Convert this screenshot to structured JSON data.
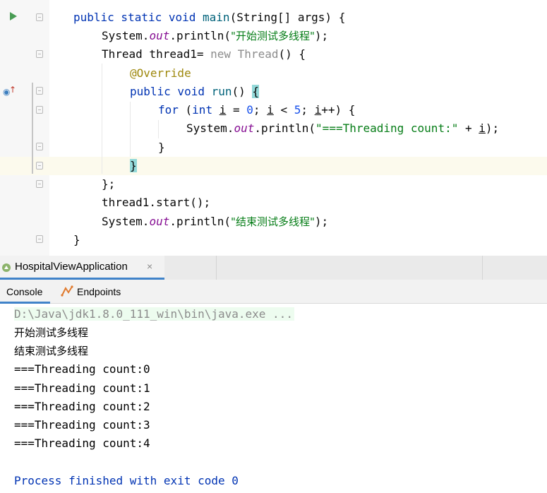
{
  "editor": {
    "lines": {
      "l1": {
        "kw1": "public static void ",
        "name": "main",
        "rest": "(String[] args) {"
      },
      "l2": {
        "a": "System.",
        "field": "out",
        "b": ".println(",
        "str": "\"开始测试多线程\"",
        "c": ");"
      },
      "l3": {
        "a": "Thread thread1= ",
        "kw": "new",
        "b": " Thread",
        "c": "() {"
      },
      "l4": {
        "ann": "@Override"
      },
      "l5": {
        "kw": "public void ",
        "name": "run",
        "b": "() ",
        "brace": "{"
      },
      "l6": {
        "kw": "for",
        "a": " (",
        "kw2": "int",
        "b": " ",
        "var": "i",
        "c": " = ",
        "n0": "0",
        "d": "; ",
        "var2": "i",
        "e": " < ",
        "n5": "5",
        "f": "; ",
        "var3": "i",
        "g": "++) {"
      },
      "l7": {
        "a": "System.",
        "field": "out",
        "b": ".println(",
        "str": "\"===Threading count:\"",
        "c": " + ",
        "var": "i",
        "d": ");"
      },
      "l8": {
        "a": "}"
      },
      "l9": {
        "brace": "}"
      },
      "l10": {
        "a": "};"
      },
      "l11": {
        "a": "thread1.start();"
      },
      "l12": {
        "a": "System.",
        "field": "out",
        "b": ".println(",
        "str": "\"结束测试多线程\"",
        "c": ");"
      },
      "l13": {
        "a": "}"
      }
    }
  },
  "run_window": {
    "tab_label": "HospitalViewApplication",
    "close_glyph": "×",
    "subtabs": {
      "console": "Console",
      "endpoints": "Endpoints"
    }
  },
  "console": {
    "command": "D:\\Java\\jdk1.8.0_111_win\\bin\\java.exe ...",
    "lines": [
      "开始测试多线程",
      "结束测试多线程",
      "===Threading count:0",
      "===Threading count:1",
      "===Threading count:2",
      "===Threading count:3",
      "===Threading count:4"
    ],
    "exit": "Process finished with exit code 0"
  },
  "icons": {
    "run_gutter": "run-arrow-icon",
    "override_gutter": "override-method-icon",
    "run_tab": "spring-boot-icon",
    "endpoints": "endpoints-icon"
  },
  "colors": {
    "keyword": "#0033b3",
    "string": "#067d17",
    "field": "#871094",
    "annotation": "#9e880d",
    "number": "#1750eb",
    "tab_accent": "#4083c9"
  }
}
